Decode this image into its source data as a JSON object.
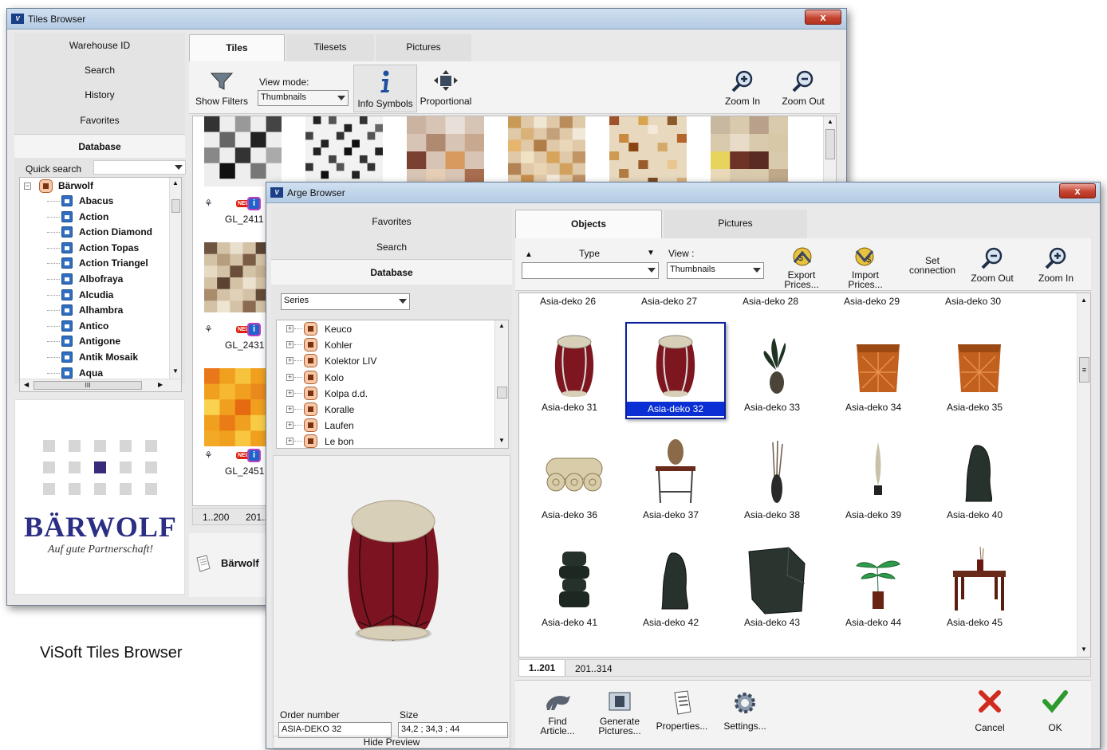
{
  "tiles_browser": {
    "title": "Tiles Browser",
    "close": "x",
    "nav": [
      "Warehouse ID",
      "Search",
      "History",
      "Favorites"
    ],
    "database_heading": "Database",
    "quick_search_label": "Quick search",
    "tree_root": "Bärwolf",
    "tree_items": [
      "Abacus",
      "Action",
      "Action Diamond",
      "Action Topas",
      "Action Triangel",
      "Albofraya",
      "Alcudia",
      "Alhambra",
      "Antico",
      "Antigone",
      "Antik Mosaik",
      "Aqua"
    ],
    "hscroll_mid": "III",
    "tabs": [
      "Tiles",
      "Tilesets",
      "Pictures"
    ],
    "toolbar": {
      "show_filters": "Show Filters",
      "view_mode_label": "View mode:",
      "view_mode_value": "Thumbnails",
      "info_symbols": "Info Symbols",
      "proportional": "Proportional",
      "zoom_in": "Zoom In",
      "zoom_out": "Zoom Out"
    },
    "tile_labels": [
      "GL_2411",
      "GL_2431",
      "GL_2451"
    ],
    "badge_new": "NEU",
    "pages": [
      "1..200",
      "201..."
    ],
    "brand_footer": "Bärwolf",
    "logo_text": "BÄRWOLF",
    "logo_tagline": "Auf gute Partnerschaft!"
  },
  "caption": "ViSoft Tiles Browser",
  "arge_browser": {
    "title": "Arge Browser",
    "close": "x",
    "nav": [
      "Favorites",
      "Search"
    ],
    "database_heading": "Database",
    "series_value": "Series",
    "tree_items": [
      "Keuco",
      "Kohler",
      "Kolektor LIV",
      "Kolo",
      "Kolpa d.d.",
      "Koralle",
      "Laufen",
      "Le bon"
    ],
    "tabs": [
      "Objects",
      "Pictures"
    ],
    "toolbar": {
      "type_label": "Type",
      "sort_up": "▲",
      "sort_down": "▼",
      "type_value": "",
      "view_label": "View :",
      "view_value": "Thumbnails",
      "export_prices": "Export Prices...",
      "import_prices": "Import Prices...",
      "set_connection": "Set connection",
      "zoom_out": "Zoom Out",
      "zoom_in": "Zoom In"
    },
    "top_row_labels": [
      "Asia-deko 26",
      "Asia-deko 27",
      "Asia-deko 28",
      "Asia-deko 29",
      "Asia-deko 30"
    ],
    "objects": [
      "Asia-deko 31",
      "Asia-deko 32",
      "Asia-deko 33",
      "Asia-deko 34",
      "Asia-deko 35",
      "Asia-deko 36",
      "Asia-deko 37",
      "Asia-deko 38",
      "Asia-deko 39",
      "Asia-deko 40",
      "Asia-deko 41",
      "Asia-deko 42",
      "Asia-deko 43",
      "Asia-deko 44",
      "Asia-deko 45"
    ],
    "selected_object": "Asia-deko 32",
    "pages": [
      "1..201",
      "201..314"
    ],
    "order_number_label": "Order number",
    "order_number_value": "ASIA-DEKO 32",
    "size_label": "Size",
    "size_value": "34,2 ; 34,3 ; 44",
    "hide_preview": "Hide Preview",
    "bottom_buttons": {
      "find_article": "Find Article...",
      "generate_pictures": "Generate Pictures...",
      "properties": "Properties...",
      "settings": "Settings...",
      "cancel": "Cancel",
      "ok": "OK"
    }
  }
}
